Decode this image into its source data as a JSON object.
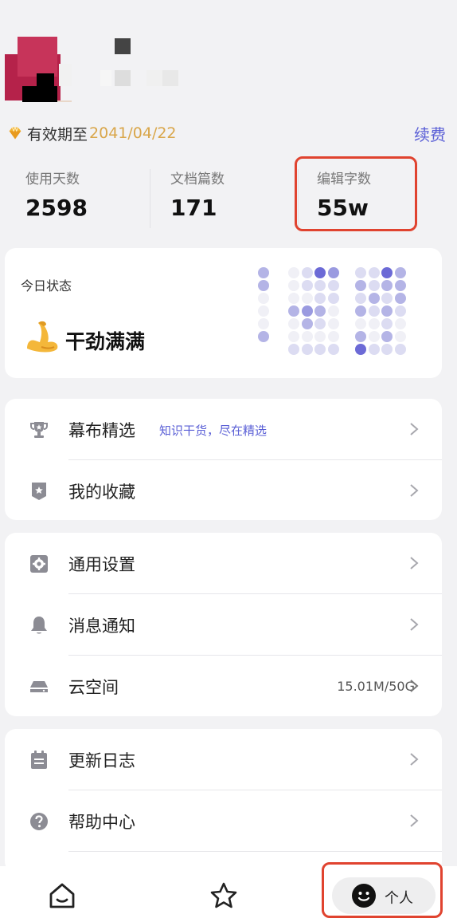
{
  "membership": {
    "label": "有效期至",
    "date": "2041/04/22",
    "renew": "续费"
  },
  "stats": [
    {
      "label": "使用天数",
      "value": "2598"
    },
    {
      "label": "文档篇数",
      "value": "171"
    },
    {
      "label": "编辑字数",
      "value": "55w"
    }
  ],
  "status": {
    "label": "今日状态",
    "emoji": "flexed-biceps",
    "text": "干劲满满"
  },
  "menu": {
    "featured": {
      "label": "幕布精选",
      "subtitle": "知识干货，尽在精选"
    },
    "favorites": {
      "label": "我的收藏"
    },
    "settings": {
      "label": "通用设置"
    },
    "notifications": {
      "label": "消息通知"
    },
    "cloud": {
      "label": "云空间",
      "value": "15.01M/50G"
    },
    "changelog": {
      "label": "更新日志"
    },
    "help": {
      "label": "帮助中心"
    }
  },
  "nav": {
    "home_icon": "home-icon",
    "star_icon": "star-icon",
    "me_label": "个人"
  },
  "colors": {
    "accent": "#5a5fd6",
    "gold": "#d9a64a",
    "highlight": "#e0432f"
  }
}
